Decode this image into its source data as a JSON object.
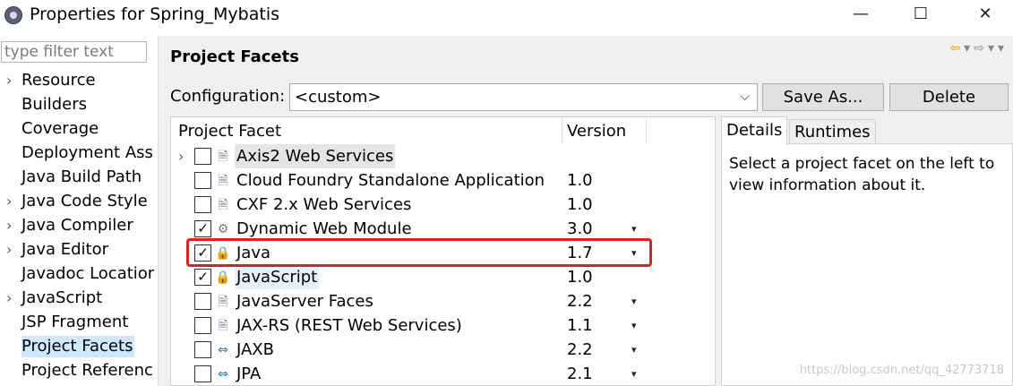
{
  "window": {
    "title": "Properties for Spring_Mybatis",
    "controls": [
      "—",
      "☐",
      "✕"
    ]
  },
  "left_panel": {
    "filter_placeholder": "type filter text",
    "items": [
      {
        "label": "Resource",
        "expandable": true,
        "selected": false
      },
      {
        "label": "Builders",
        "expandable": false,
        "selected": false
      },
      {
        "label": "Coverage",
        "expandable": false,
        "selected": false
      },
      {
        "label": "Deployment Ass",
        "expandable": false,
        "selected": false
      },
      {
        "label": "Java Build Path",
        "expandable": false,
        "selected": false
      },
      {
        "label": "Java Code Style",
        "expandable": true,
        "selected": false
      },
      {
        "label": "Java Compiler",
        "expandable": true,
        "selected": false
      },
      {
        "label": "Java Editor",
        "expandable": true,
        "selected": false
      },
      {
        "label": "Javadoc Locatior",
        "expandable": false,
        "selected": false
      },
      {
        "label": "JavaScript",
        "expandable": true,
        "selected": false
      },
      {
        "label": "JSP Fragment",
        "expandable": false,
        "selected": false
      },
      {
        "label": "Project Facets",
        "expandable": false,
        "selected": true
      },
      {
        "label": "Project Referenc",
        "expandable": false,
        "selected": false
      }
    ]
  },
  "main": {
    "title": "Project Facets",
    "configuration_label": "Configuration:",
    "configuration_value": "<custom>",
    "save_as_label": "Save As...",
    "delete_label": "Delete",
    "table": {
      "headers": {
        "facet": "Project Facet",
        "version": "Version"
      },
      "rows": [
        {
          "name": "Axis2 Web Services",
          "version": "",
          "checked": false,
          "expandable": true,
          "icon": "document-icon",
          "has_dropdown": false,
          "style": "hover"
        },
        {
          "name": "Cloud Foundry Standalone Application",
          "version": "1.0",
          "checked": false,
          "expandable": false,
          "icon": "document-icon",
          "has_dropdown": false,
          "style": ""
        },
        {
          "name": "CXF 2.x Web Services",
          "version": "1.0",
          "checked": false,
          "expandable": false,
          "icon": "document-icon",
          "has_dropdown": false,
          "style": ""
        },
        {
          "name": "Dynamic Web Module",
          "version": "3.0",
          "checked": true,
          "expandable": false,
          "icon": "web-module-icon",
          "has_dropdown": true,
          "style": ""
        },
        {
          "name": "Java",
          "version": "1.7",
          "checked": true,
          "expandable": false,
          "icon": "java-lock-icon",
          "has_dropdown": true,
          "style": ""
        },
        {
          "name": "JavaScript",
          "version": "1.0",
          "checked": true,
          "expandable": false,
          "icon": "javascript-lock-icon",
          "has_dropdown": false,
          "style": "selected"
        },
        {
          "name": "JavaServer Faces",
          "version": "2.2",
          "checked": false,
          "expandable": false,
          "icon": "document-icon",
          "has_dropdown": true,
          "style": ""
        },
        {
          "name": "JAX-RS (REST Web Services)",
          "version": "1.1",
          "checked": false,
          "expandable": false,
          "icon": "document-icon",
          "has_dropdown": true,
          "style": ""
        },
        {
          "name": "JAXB",
          "version": "2.2",
          "checked": false,
          "expandable": false,
          "icon": "jaxb-arrows-icon",
          "has_dropdown": true,
          "style": ""
        },
        {
          "name": "JPA",
          "version": "2.1",
          "checked": false,
          "expandable": false,
          "icon": "jpa-arrows-icon",
          "has_dropdown": true,
          "style": ""
        }
      ]
    },
    "details": {
      "tabs": [
        "Details",
        "Runtimes"
      ],
      "body_text": "Select a project facet on the left to view information about it."
    }
  },
  "watermark": "https://blog.csdn.net/qq_42773718",
  "colors": {
    "highlight_box": "#e02020",
    "selection": "#cde8ff"
  }
}
